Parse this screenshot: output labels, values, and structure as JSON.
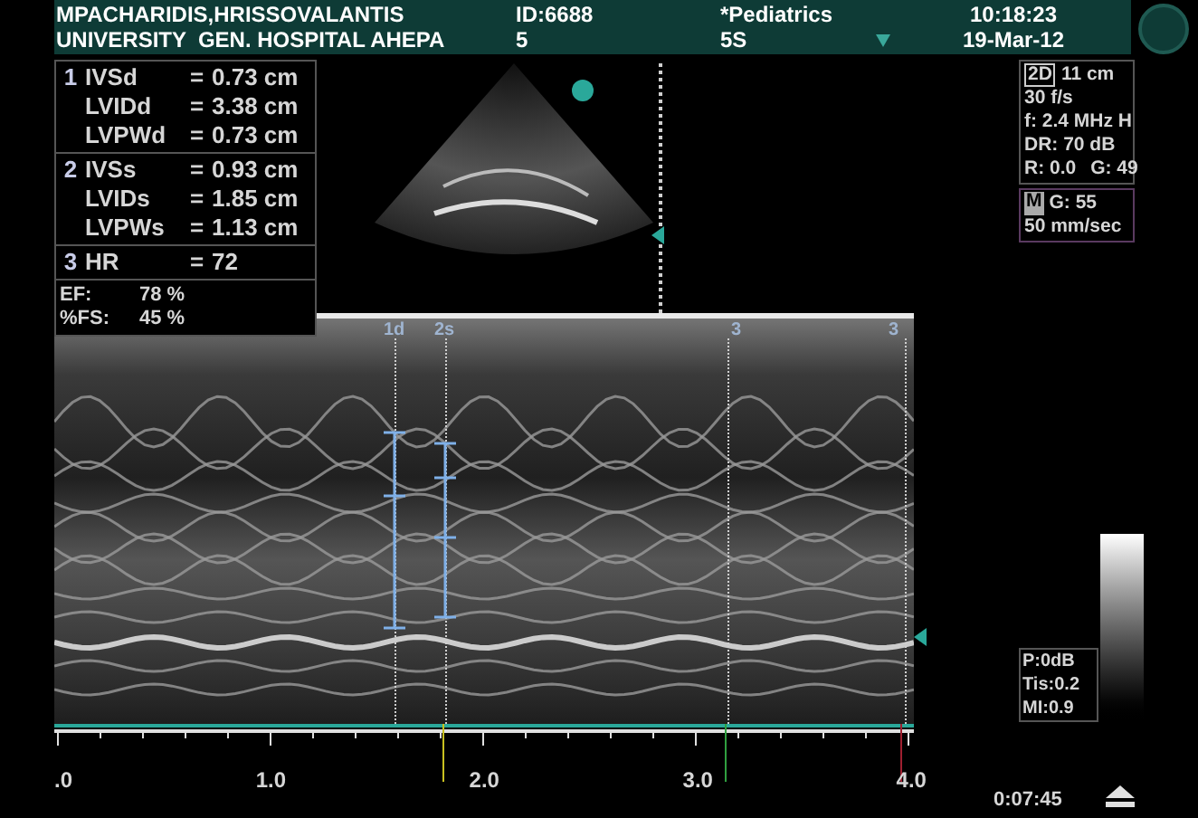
{
  "header": {
    "patient": "MPACHARIDIS,HRISSOVALANTIS",
    "institution": "UNIVERSITY  GEN. HOSPITAL AHEPA",
    "id": "ID:6688",
    "id_line_2": "5",
    "preset": "*Pediatrics",
    "probe": "5S",
    "time": "10:18:23",
    "date": "19-Mar-12"
  },
  "measurements": [
    {
      "index": "1",
      "rows": [
        {
          "name": "IVSd",
          "eq": "=",
          "value": "0.73 cm"
        },
        {
          "name": "LVIDd",
          "eq": "=",
          "value": "3.38 cm"
        },
        {
          "name": "LVPWd",
          "eq": "=",
          "value": "0.73 cm"
        }
      ]
    },
    {
      "index": "2",
      "rows": [
        {
          "name": "IVSs",
          "eq": "=",
          "value": "0.93 cm"
        },
        {
          "name": "LVIDs",
          "eq": "=",
          "value": "1.85 cm"
        },
        {
          "name": "LVPWs",
          "eq": "=",
          "value": "1.13 cm"
        }
      ]
    },
    {
      "index": "3",
      "rows": [
        {
          "name": "HR",
          "eq": "=",
          "value": "72"
        }
      ]
    }
  ],
  "results": [
    {
      "label": "EF:",
      "value": "78 %"
    },
    {
      "label": "%FS:",
      "value": "45 %"
    }
  ],
  "mode_2d": {
    "badge": "2D",
    "depth": "11 cm",
    "lines": [
      [
        "30 f/s"
      ],
      [
        "f: 2.4 MHz H"
      ],
      [
        "DR: 70 dB"
      ],
      [
        "R: 0.0",
        "G: 49"
      ]
    ]
  },
  "mode_m": {
    "badge": "M",
    "gain": "G: 55",
    "speed": "50 mm/sec"
  },
  "output": [
    "P:0dB",
    "Tis:0.2",
    "MI:0.9"
  ],
  "mmode": {
    "markers": [
      {
        "label": "1d"
      },
      {
        "label": "2s"
      },
      {
        "label": "3"
      },
      {
        "label": "3"
      }
    ]
  },
  "axis": {
    "ticks": [
      ".0",
      "1.0",
      "2.0",
      "3.0",
      "4.0"
    ]
  },
  "elapsed": "0:07:45"
}
